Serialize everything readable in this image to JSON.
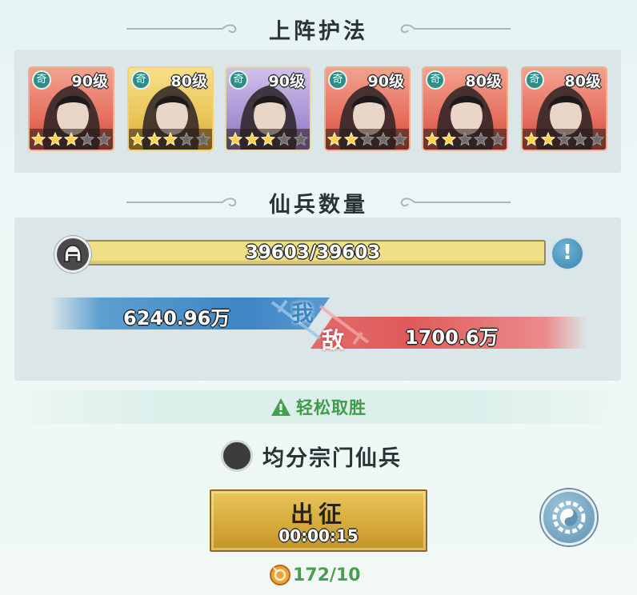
{
  "sections": {
    "guardians_title": "上阵护法",
    "troops_title": "仙兵数量"
  },
  "heroes": [
    {
      "level": "90级",
      "badge": "奇",
      "frame": "red",
      "stars_lit": 3,
      "stars_total": 5
    },
    {
      "level": "80级",
      "badge": "奇",
      "frame": "gold",
      "stars_lit": 3,
      "stars_total": 5
    },
    {
      "level": "90级",
      "badge": "奇",
      "frame": "purple",
      "stars_lit": 3,
      "stars_total": 5
    },
    {
      "level": "90级",
      "badge": "奇",
      "frame": "red",
      "stars_lit": 2,
      "stars_total": 5
    },
    {
      "level": "80级",
      "badge": "奇",
      "frame": "red",
      "stars_lit": 2,
      "stars_total": 5
    },
    {
      "level": "80级",
      "badge": "奇",
      "frame": "red",
      "stars_lit": 2,
      "stars_total": 5
    }
  ],
  "troops": {
    "value": "39603/39603",
    "fill_fraction": 1.0
  },
  "versus": {
    "ours_value": "6240.96万",
    "ours_label": "我",
    "enemy_value": "1700.6万",
    "enemy_label": "敌"
  },
  "outcome": "轻松取胜",
  "split_option": "均分宗门仙兵",
  "march": {
    "label": "出征",
    "timer": "00:00:15"
  },
  "cost": "172/10",
  "colors": {
    "our_side": "#3d86c4",
    "enemy_side": "#e05a5a",
    "outcome_green": "#3f9a4a",
    "troop_bar": "#efe086",
    "button_gold": "#d8ad3e"
  },
  "icons": {
    "troop": "helmet-icon",
    "info": "exclamation-icon",
    "warning": "warning-triangle-icon",
    "settings": "yin-yang-gear-icon",
    "cost": "coin-icon"
  }
}
